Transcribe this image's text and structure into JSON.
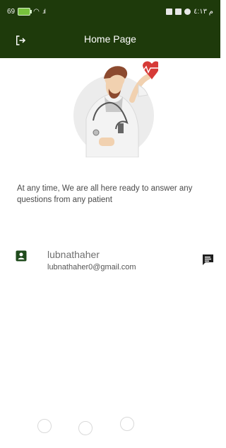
{
  "status_bar": {
    "left_text": "69",
    "right_text": "م ٤:١٣",
    "icons": [
      "battery-icon",
      "wifi-icon",
      "signal-icon",
      "video-icon",
      "square-icon",
      "navigation-icon"
    ]
  },
  "app_bar": {
    "title": "Home Page",
    "logout_icon": "logout-icon"
  },
  "main": {
    "message": "At any time, We are all here ready to answer any questions from any patient"
  },
  "user": {
    "username": "lubnathaher",
    "email": "lubnathaher0@gmail.com",
    "contact_icon": "contact-icon",
    "chat_icon": "chat-icon"
  },
  "pager": {
    "dot_count": 3
  },
  "colors": {
    "app_bar_bg": "#1e3a0b",
    "icon_green": "#1f4b1c",
    "heart_red": "#d63a37"
  }
}
